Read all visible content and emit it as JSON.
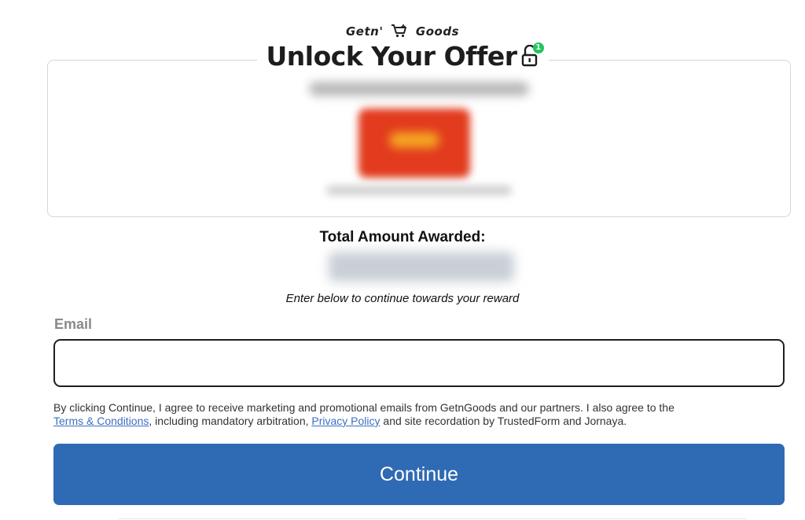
{
  "brand": {
    "left": "Getn'",
    "right": "Goods",
    "logo_icon": "cart-plus-icon"
  },
  "header": {
    "title": "Unlock Your Offer",
    "lock_icon": "unlock-icon",
    "badge_count": "1"
  },
  "reward": {
    "total_label": "Total Amount Awarded:"
  },
  "form": {
    "hint": "Enter below to continue towards your reward",
    "email_label": "Email",
    "email_value": "",
    "email_placeholder": ""
  },
  "legal": {
    "text_1": "By clicking Continue, I agree to receive marketing and promotional emails from GetnGoods and our partners. I also agree to the",
    "terms_link": "Terms & Conditions",
    "text_2": ", including mandatory arbitration,",
    "privacy_link": "Privacy Policy",
    "text_3": "and site recordation by TrustedForm and Jornaya."
  },
  "actions": {
    "continue_label": "Continue"
  },
  "colors": {
    "primary": "#2f6ab4",
    "link": "#3b6fc2",
    "badge": "#22c55e"
  }
}
